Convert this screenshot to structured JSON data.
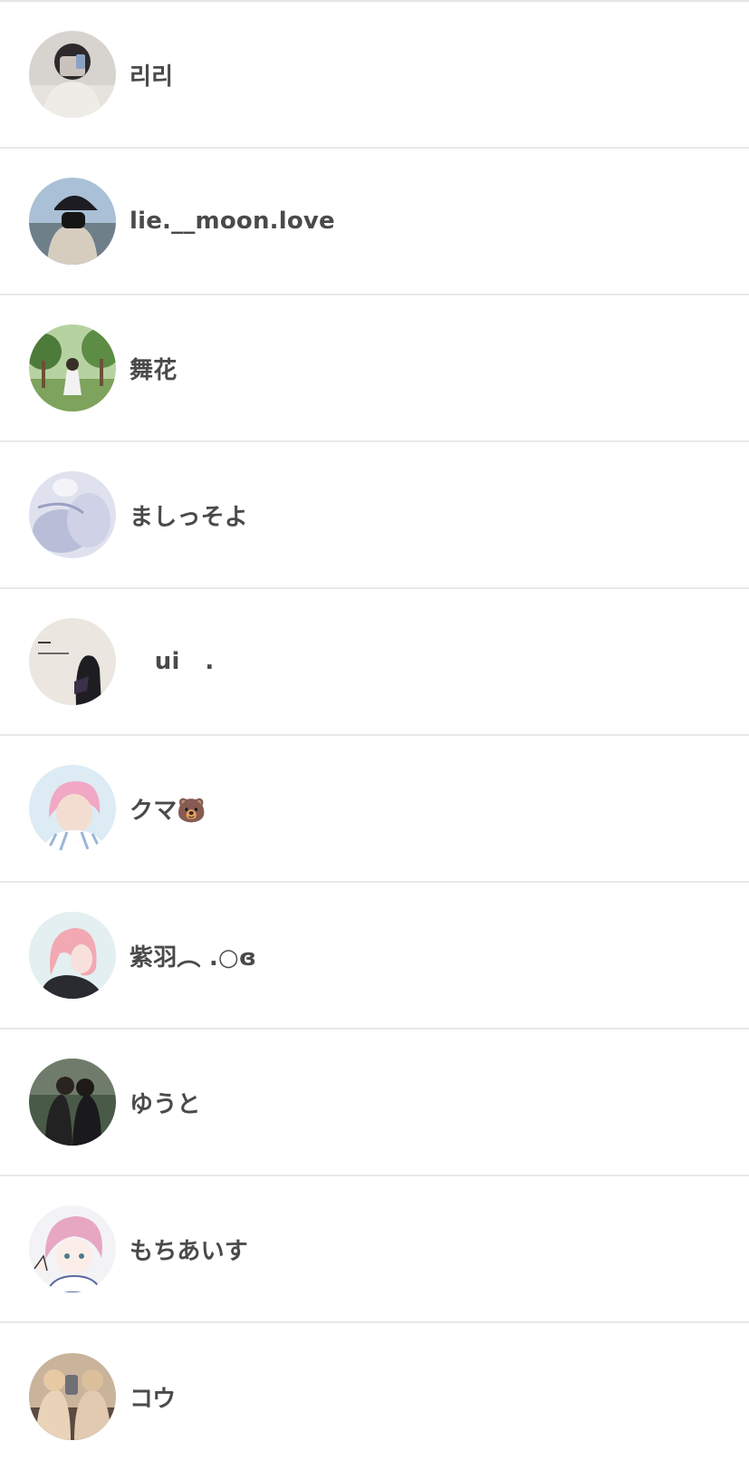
{
  "users": [
    {
      "name": "리리",
      "avatar": "avatar-photo"
    },
    {
      "name": "lie.__moon.love",
      "avatar": "avatar-photo"
    },
    {
      "name": "舞花",
      "avatar": "avatar-photo"
    },
    {
      "name": "ましっそよ",
      "avatar": "avatar-photo"
    },
    {
      "name": "   ui   .",
      "avatar": "avatar-photo"
    },
    {
      "name": "クマ🐻",
      "avatar": "avatar-photo"
    },
    {
      "name": "紫羽︵ .○ɞ",
      "avatar": "avatar-illustration"
    },
    {
      "name": "ゆうと",
      "avatar": "avatar-photo"
    },
    {
      "name": "もちあいす",
      "avatar": "avatar-illustration"
    },
    {
      "name": "コウ",
      "avatar": "avatar-photo"
    }
  ],
  "colors": {
    "divider": "#e9e9e9",
    "name_text": "#4a4a4a",
    "background": "#ffffff"
  }
}
